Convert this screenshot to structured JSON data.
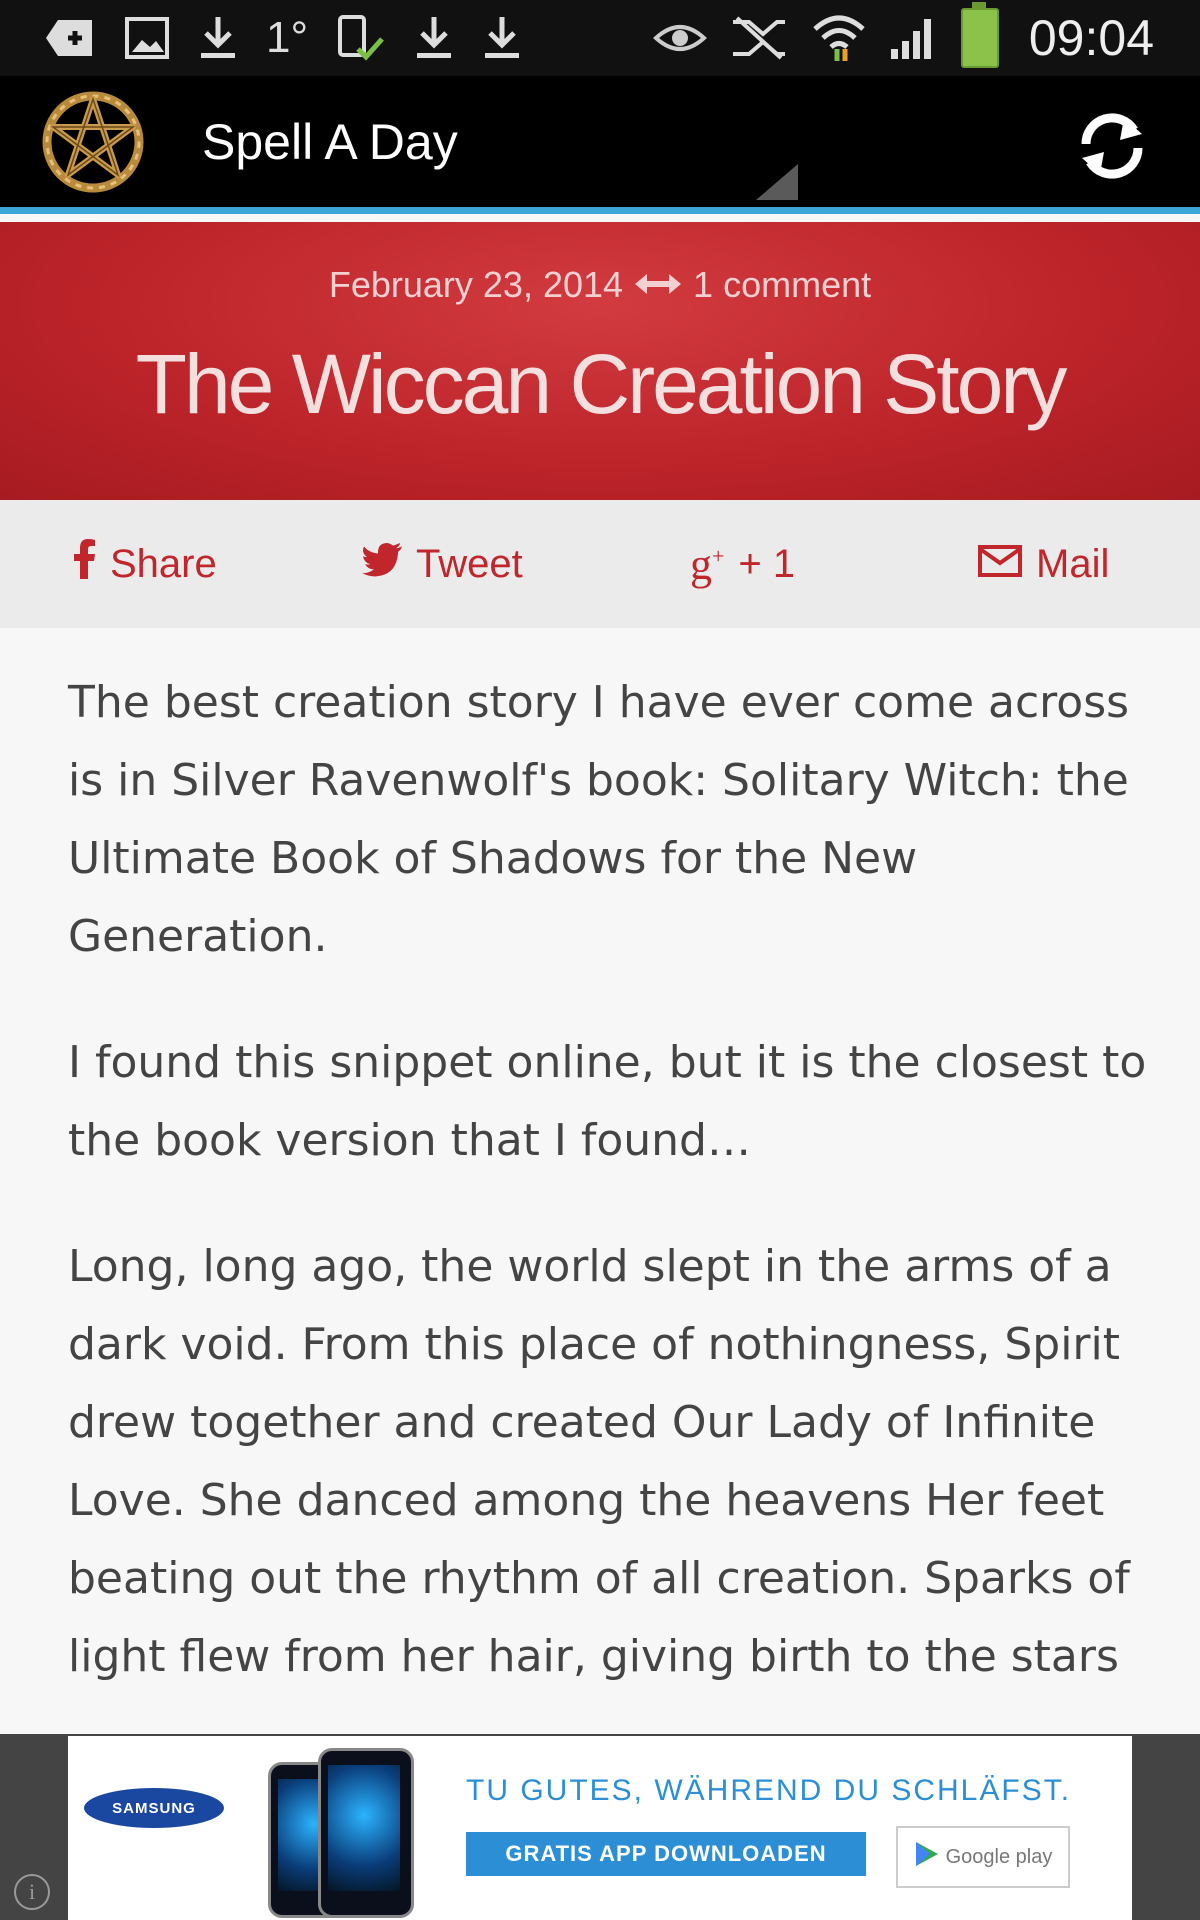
{
  "status_bar": {
    "time": "09:04",
    "temp": "1°",
    "icons": [
      "add-icon",
      "image-icon",
      "download-icon",
      "temperature-icon",
      "phone-check-icon",
      "download-icon",
      "download-icon",
      "eye-icon",
      "mute-icon",
      "wifi-icon",
      "signal-icon",
      "battery-icon"
    ]
  },
  "app_bar": {
    "title": "Spell A Day",
    "logo_icon": "pentagram-icon",
    "refresh_icon": "refresh-icon"
  },
  "post": {
    "date": "February 23, 2014",
    "comments": "1 comment",
    "title": "The Wiccan Creation Story"
  },
  "share": {
    "facebook": "Share",
    "twitter": "Tweet",
    "gplus": "+ 1",
    "mail": "Mail"
  },
  "article": {
    "p1": "The best creation story I have ever come across is in Silver Ravenwolf's book: Solitary Witch: the Ultimate Book of Shadows for the New Generation.",
    "p2": "I found this snippet online, but it is the closest to the book version that I found…",
    "p3": "Long, long ago, the world slept in the arms of a dark void. From this place of nothingness, Spirit drew together and created Our Lady of Infinite Love. She danced among the heavens Her feet beating out the rhythm of all creation. Sparks of light flew from her hair, giving birth to the stars"
  },
  "ad": {
    "brand": "SAMSUNG",
    "headline": "TU GUTES, WÄHREND DU SCHLÄFST.",
    "cta": "GRATIS APP DOWNLOADEN",
    "store": "Google play",
    "info": "i"
  },
  "colors": {
    "accent": "#3da6d9",
    "hero_red": "#bb2329",
    "share_red": "#c0262c",
    "ad_blue": "#2c8fd6"
  }
}
